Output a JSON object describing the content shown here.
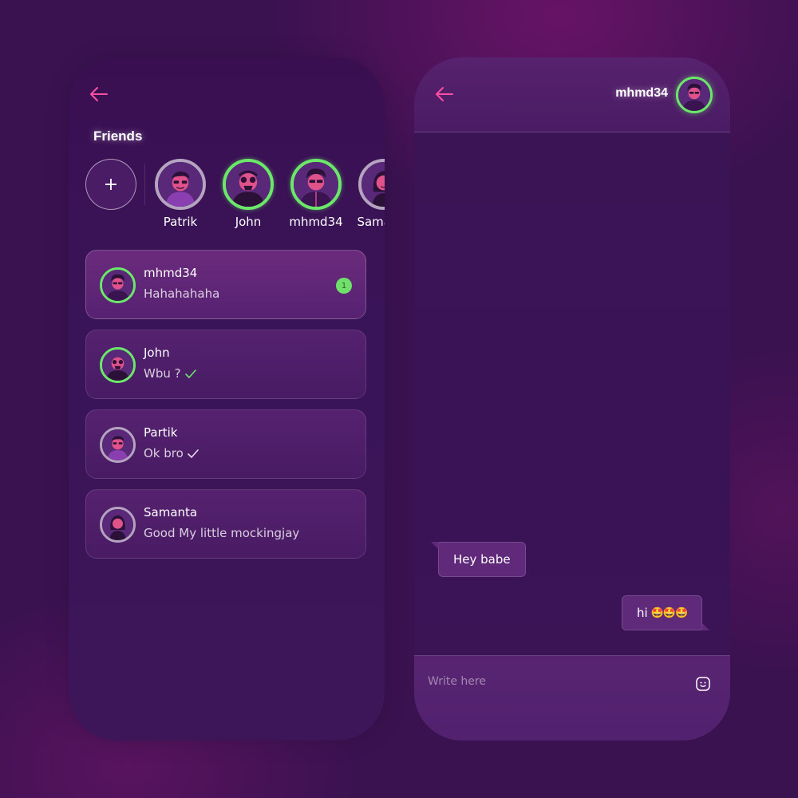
{
  "friends_panel": {
    "title": "Friends",
    "add_label": "+",
    "friends": [
      {
        "name": "Patrik",
        "online": false,
        "avatar": "avatar-patrik"
      },
      {
        "name": "John",
        "online": true,
        "avatar": "avatar-john"
      },
      {
        "name": "mhmd34",
        "online": true,
        "avatar": "avatar-mhmd34"
      },
      {
        "name": "Samanta",
        "online": false,
        "avatar": "avatar-samanta"
      }
    ]
  },
  "chats": [
    {
      "name": "mhmd34",
      "message": "Hahahahaha",
      "online": true,
      "unread": "1",
      "active": true
    },
    {
      "name": "John",
      "message": "Wbu ?",
      "online": true,
      "status_icon": "check-icon-green"
    },
    {
      "name": "Partik",
      "message": "Ok bro",
      "online": false,
      "status_icon": "check-icon-white"
    },
    {
      "name": "Samanta",
      "message": "Good My little mockingjay",
      "online": false
    }
  ],
  "conversation": {
    "contact_name": "mhmd34",
    "messages": [
      {
        "direction": "in",
        "text": "Hey babe"
      },
      {
        "direction": "out",
        "text": "hi",
        "emoji": "🤩🤩🤩"
      }
    ],
    "input_placeholder": "Write here"
  },
  "colors": {
    "accent_pink": "#ff4fa0",
    "online_green": "#6be86a",
    "offline_gray": "#b4a4bf",
    "background": "#3a1250"
  },
  "icons": [
    "back-arrow-icon",
    "plus-icon",
    "check-icon",
    "smiley-icon"
  ]
}
